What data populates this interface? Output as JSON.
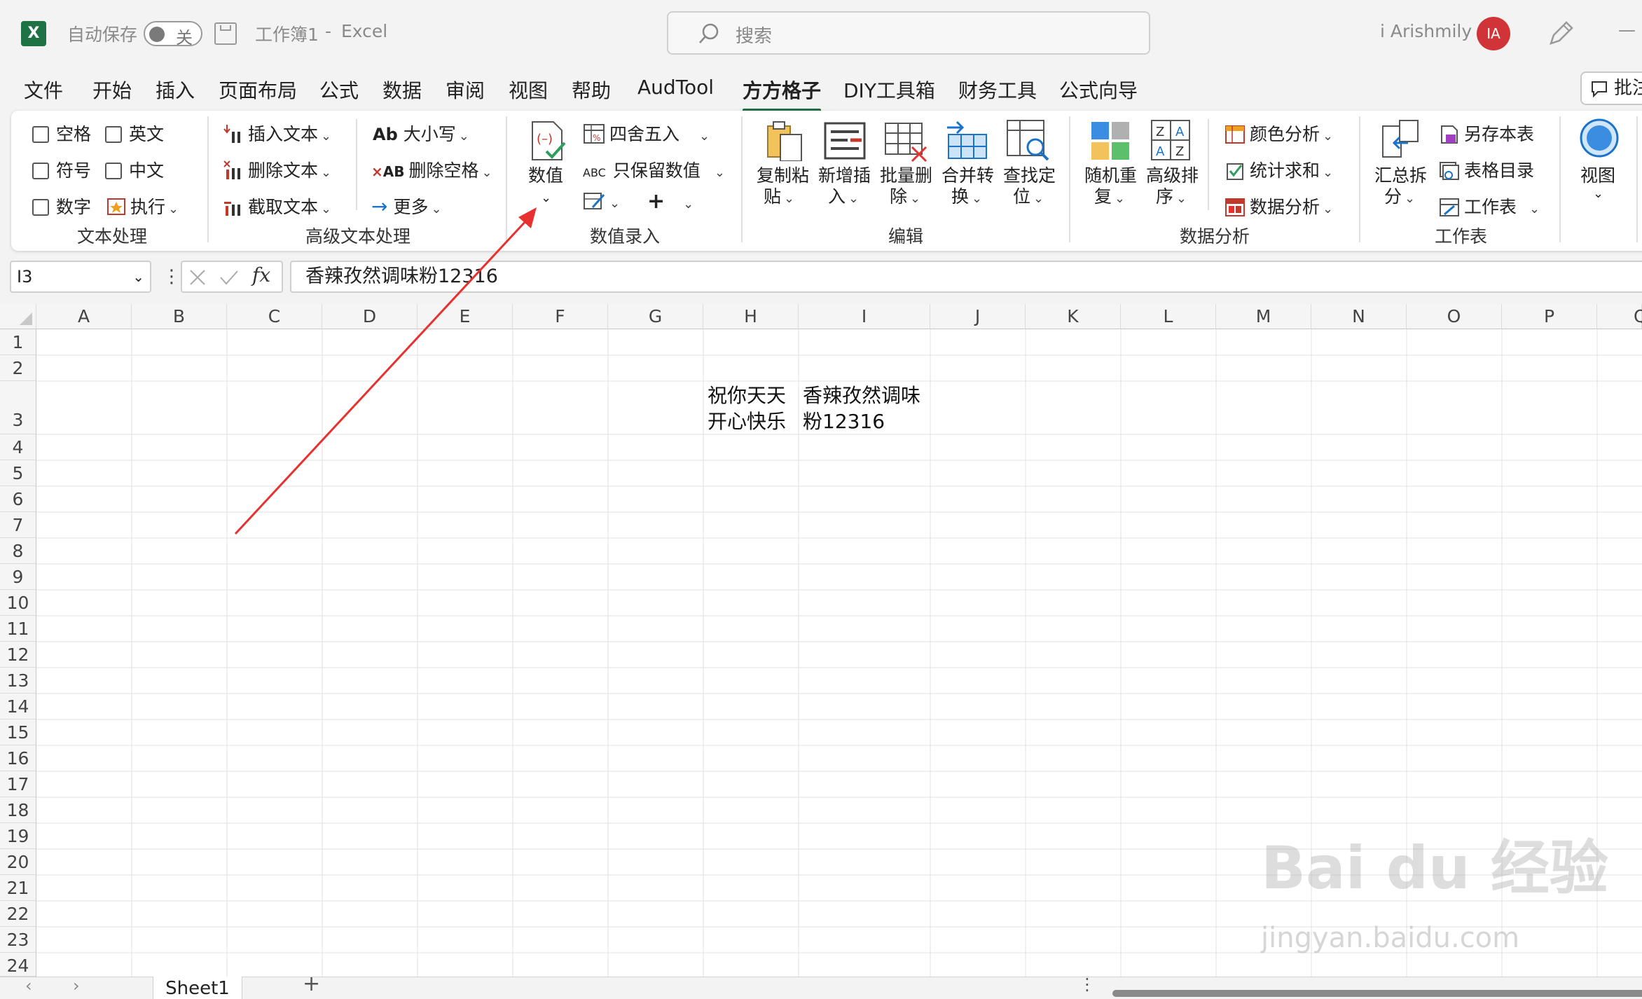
{
  "titlebar": {
    "autosave_label": "自动保存",
    "autosave_state": "关",
    "doc_title": "工作簿1",
    "separator": "-",
    "app_name": "Excel",
    "search_placeholder": "搜索",
    "user_name": "i Arishmily",
    "user_initials": "IA",
    "minimize_glyph": "—"
  },
  "menu": {
    "tabs": [
      "文件",
      "开始",
      "插入",
      "页面布局",
      "公式",
      "数据",
      "审阅",
      "视图",
      "帮助",
      "AudTool",
      "方方格子",
      "DIY工具箱",
      "财务工具",
      "公式向导"
    ],
    "active_tab": "方方格子",
    "comment_button": "批注"
  },
  "ribbon": {
    "text_group": {
      "label": "文本处理",
      "checkboxes": [
        "空格",
        "英文",
        "符号",
        "中文",
        "数字"
      ],
      "execute": "执行"
    },
    "advanced_text_group": {
      "label": "高级文本处理",
      "insert_text": "插入文本",
      "delete_text": "删除文本",
      "extract_text": "截取文本",
      "case": "大小写",
      "delete_space": "删除空格",
      "more": "更多"
    },
    "numeric_group": {
      "label": "数值录入",
      "numeric": "数值",
      "round": "四舍五入",
      "keep_value": "只保留数值"
    },
    "edit_group": {
      "label": "编辑",
      "copy_paste": [
        "复制粘",
        "贴"
      ],
      "new_insert": [
        "新增插",
        "入"
      ],
      "batch_delete": [
        "批量删",
        "除"
      ],
      "merge_convert": [
        "合并转",
        "换"
      ],
      "find_locate": [
        "查找定",
        "位"
      ]
    },
    "analysis_group": {
      "label": "数据分析",
      "random_repeat": [
        "随机重",
        "复"
      ],
      "advanced_sort": [
        "高级排",
        "序"
      ],
      "color_analysis": "颜色分析",
      "stat_sum": "统计求和",
      "data_analysis": "数据分析"
    },
    "worksheet_group": {
      "label": "工作表",
      "summary_split": [
        "汇总拆",
        "分"
      ],
      "save_sheet": "另存本表",
      "table_catalog": "表格目录",
      "worksheet": "工作表"
    },
    "view_group": {
      "view": "视图"
    }
  },
  "formula_bar": {
    "name_box": "I3",
    "fx": "fx",
    "content": "香辣孜然调味粉12316"
  },
  "grid": {
    "columns": [
      "A",
      "B",
      "C",
      "D",
      "E",
      "F",
      "G",
      "H",
      "I",
      "J",
      "K",
      "L",
      "M",
      "N",
      "O",
      "P",
      "Q"
    ],
    "rows": [
      "1",
      "2",
      "3",
      "4",
      "5",
      "6",
      "7",
      "8",
      "9",
      "10",
      "11",
      "12",
      "13",
      "14",
      "15",
      "16",
      "17",
      "18",
      "19",
      "20",
      "21",
      "22",
      "23",
      "24"
    ],
    "cells": {
      "H3_line1": "祝你天天",
      "H3_line2": "开心快乐",
      "I3_line1": "香辣孜然调味",
      "I3_line2": "粉12316"
    }
  },
  "sheets": {
    "active": "Sheet1",
    "add": "+"
  },
  "watermark": {
    "brand": "Bai du 经验",
    "url": "jingyan.baidu.com"
  },
  "colors": {
    "excel_green": "#1f7244",
    "annotation_arrow": "#e8312f",
    "avatar_red": "#d13438"
  }
}
